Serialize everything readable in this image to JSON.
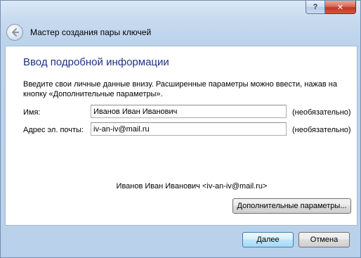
{
  "titlebar": {
    "help_label": "?",
    "close_label": "✕"
  },
  "header": {
    "title": "Мастер создания пары ключей"
  },
  "page": {
    "heading": "Ввод подробной информации",
    "intro": "Введите свои личные данные внизу. Расширенные параметры можно ввести, нажав на кнопку «Дополнительные параметры».",
    "name_label": "Имя:",
    "name_value": "Иванов Иван Иванович",
    "name_optional": "(необязательно)",
    "email_label": "Адрес эл. почты:",
    "email_value": "iv-an-iv@mail.ru",
    "email_optional": "(необязательно)",
    "summary": "Иванов Иван Иванович <iv-an-iv@mail.ru>",
    "advanced_button": "Дополнительные параметры..."
  },
  "footer": {
    "next_button": "Далее",
    "cancel_button": "Отмена"
  }
}
